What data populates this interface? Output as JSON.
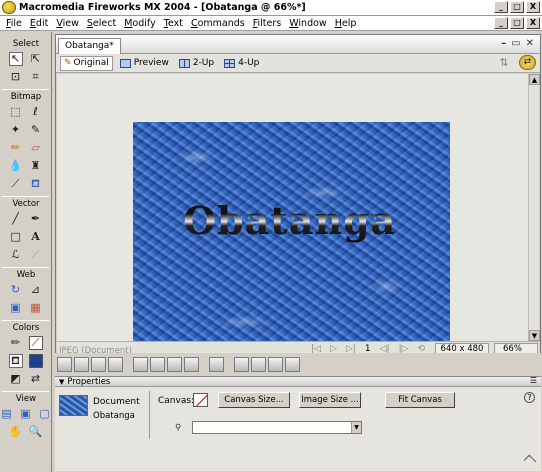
{
  "window": {
    "title": "Macromedia Fireworks MX 2004 - [Obatanga @ 66%*]",
    "minimize": "_",
    "maximize": "□",
    "close": "X"
  },
  "menu": [
    "File",
    "Edit",
    "View",
    "Select",
    "Modify",
    "Text",
    "Commands",
    "Filters",
    "Window",
    "Help"
  ],
  "tools": {
    "select_heading": "Select",
    "bitmap_heading": "Bitmap",
    "vector_heading": "Vector",
    "web_heading": "Web",
    "colors_heading": "Colors",
    "view_heading": "View"
  },
  "document": {
    "tab": "Obatanga*",
    "views": [
      "Original",
      "Preview",
      "2-Up",
      "4-Up"
    ],
    "artwork_text": "Obatanga",
    "status_left": "JPEG (Document)",
    "page": "1",
    "dimensions": "640 x 480",
    "zoom": "66%"
  },
  "properties": {
    "heading": "Properties",
    "doc_label": "Document",
    "doc_name": "Obatanga",
    "canvas_label": "Canvas:",
    "canvas_size_button": "Canvas Size...",
    "image_size_button": "Image Size ...",
    "fit_canvas_button": "Fit Canvas",
    "help": "?"
  },
  "colors": {
    "canvas_stroke": "#d00000",
    "artwork_base": "#3c6cc0"
  }
}
